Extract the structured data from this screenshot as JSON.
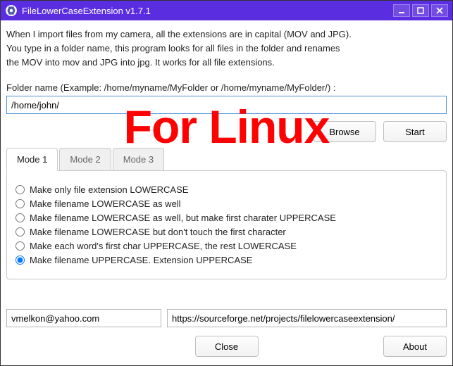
{
  "title": "FileLowerCaseExtension v1.7.1",
  "watermark": "For Linux",
  "description": {
    "line1": "When I import files from my camera, all the extensions are in capital (MOV and JPG).",
    "line2": "You type in a folder name, this program looks for all files in the folder and renames",
    "line3": "the MOV into mov and JPG into jpg. It works for all file extensions."
  },
  "folder": {
    "label": "Folder name (Example: /home/myname/MyFolder or /home/myname/MyFolder/) :",
    "value": "/home/john/"
  },
  "buttons": {
    "browse": "Browse",
    "start": "Start",
    "close": "Close",
    "about": "About"
  },
  "tabs": {
    "items": [
      {
        "label": "Mode 1"
      },
      {
        "label": "Mode 2"
      },
      {
        "label": "Mode 3"
      }
    ],
    "active_index": 0
  },
  "options": {
    "selected_index": 5,
    "items": [
      {
        "label": "Make only file extension LOWERCASE"
      },
      {
        "label": "Make filename LOWERCASE as well"
      },
      {
        "label": "Make filename LOWERCASE as well, but make first charater UPPERCASE"
      },
      {
        "label": "Make filename LOWERCASE but don't touch the first character"
      },
      {
        "label": "Make each word's first char UPPERCASE, the rest LOWERCASE"
      },
      {
        "label": "Make filename UPPERCASE. Extension UPPERCASE"
      }
    ]
  },
  "bottom": {
    "email": "vmelkon@yahoo.com",
    "url": "https://sourceforge.net/projects/filelowercaseextension/"
  }
}
